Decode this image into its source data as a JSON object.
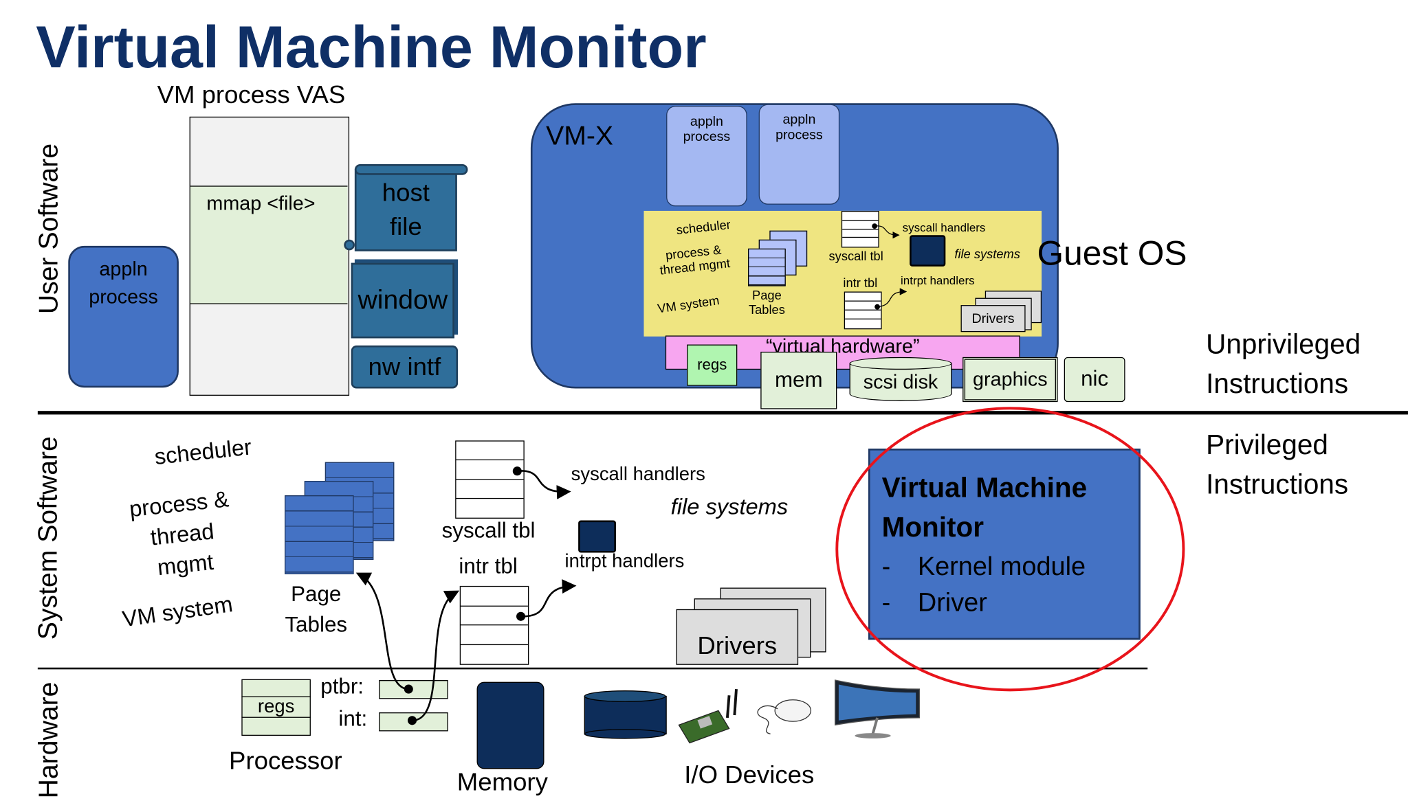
{
  "title": "Virtual Machine Monitor",
  "sections": {
    "user": "User Software",
    "system": "System Software",
    "hardware": "Hardware"
  },
  "vas": {
    "label": "VM process VAS",
    "mmap": "mmap <file>",
    "host_file": "host file",
    "window": "window",
    "nw_intf": "nw intf"
  },
  "user_app": "appln process",
  "vmx": {
    "label": "VM-X",
    "app1": "appln process",
    "app2": "appln process",
    "guest_os": "Guest OS",
    "guest": {
      "scheduler": "scheduler",
      "ptm": "process & thread mgmt",
      "vm": "VM system",
      "page_tables": "Page Tables",
      "syscall_tbl": "syscall tbl",
      "syscall_handlers": "syscall handlers",
      "file_systems": "file systems",
      "intr_tbl": "intr tbl",
      "intrpt_handlers": "intrpt handlers",
      "drivers": "Drivers"
    },
    "virtual_hw": "“virtual hardware”",
    "regs": "regs",
    "mem": "mem",
    "scsi": "scsi disk",
    "graphics": "graphics",
    "nic": "nic"
  },
  "unprivileged": "Unprivileged Instructions",
  "privileged": "Privileged Instructions",
  "sys": {
    "scheduler": "scheduler",
    "ptm": "process & thread mgmt",
    "vm": "VM system",
    "page_tables": "Page Tables",
    "syscall_tbl": "syscall tbl",
    "syscall_handlers": "syscall handlers",
    "file_systems": "file systems",
    "intr_tbl": "intr tbl",
    "intrpt_handlers": "intrpt handlers",
    "drivers": "Drivers"
  },
  "vmm": {
    "title": "Virtual Machine Monitor",
    "items": [
      "Kernel module",
      "Driver"
    ],
    "bullet": "-",
    "highlight_color": "#e8141b"
  },
  "hw": {
    "regs": "regs",
    "ptbr": "ptbr:",
    "int": "int:",
    "processor": "Processor",
    "memory": "Memory",
    "io": "I/O Devices"
  },
  "colors": {
    "title": "#0f2f66",
    "box_blue": "#4472c4",
    "guest_yellow": "#efe581",
    "virtual_hw_pink": "#f7a6f0"
  }
}
